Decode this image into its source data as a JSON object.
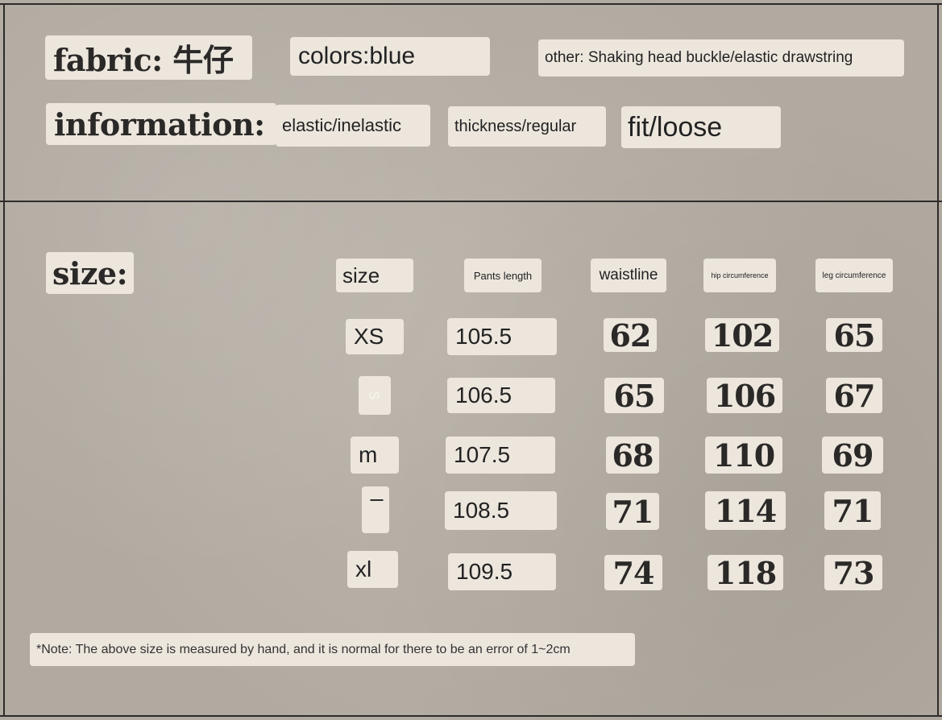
{
  "labels": {
    "fabric": "fabric: 牛仔",
    "information": "information:",
    "size": "size:"
  },
  "fabric_details": {
    "colors": "colors:blue",
    "other": "other: Shaking head buckle/elastic drawstring"
  },
  "information_details": {
    "elastic": "elastic/inelastic",
    "thickness": "thickness/regular",
    "fit": "fit/loose"
  },
  "size_table": {
    "headers": [
      "size",
      "Pants length",
      "waistline",
      "hip circumference",
      "leg circumference"
    ],
    "rows": [
      [
        "XS",
        "105.5",
        "62",
        "102",
        "65"
      ],
      [
        "s",
        "106.5",
        "65",
        "106",
        "67"
      ],
      [
        "m",
        "107.5",
        "68",
        "110",
        "69"
      ],
      [
        "l",
        "108.5",
        "71",
        "114",
        "71"
      ],
      [
        "xl",
        "109.5",
        "74",
        "118",
        "73"
      ]
    ]
  },
  "note": "*Note: The above size is measured by hand, and it is normal for there to be an error of 1~2cm"
}
